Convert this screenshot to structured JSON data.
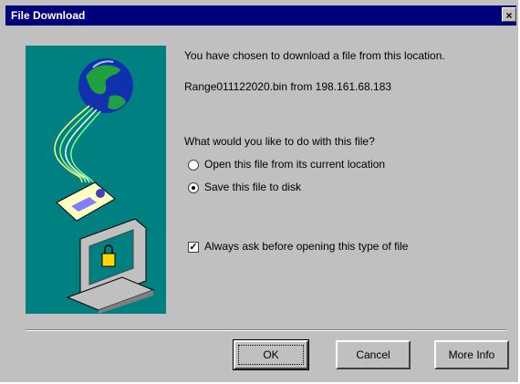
{
  "window": {
    "title": "File Download",
    "close_label": "×"
  },
  "dialog": {
    "intro": "You have chosen to download a file from this location.",
    "file_line": "Range011122020.bin from 198.161.68.183",
    "question": "What would you like to do with this file?",
    "options": [
      {
        "label": "Open this file from its current location",
        "selected": false
      },
      {
        "label": "Save this file to disk",
        "selected": true
      }
    ],
    "always_ask": {
      "label": "Always ask before opening this type of file",
      "checked": true
    }
  },
  "buttons": {
    "ok": "OK",
    "cancel": "Cancel",
    "more_info": "More Info"
  },
  "colors": {
    "title_bar": "#00007b",
    "dialog_bg": "#c0c0c0",
    "art_bg": "#008080"
  },
  "icons": [
    "globe-icon",
    "envelope-icon",
    "computer-icon",
    "close-icon"
  ]
}
